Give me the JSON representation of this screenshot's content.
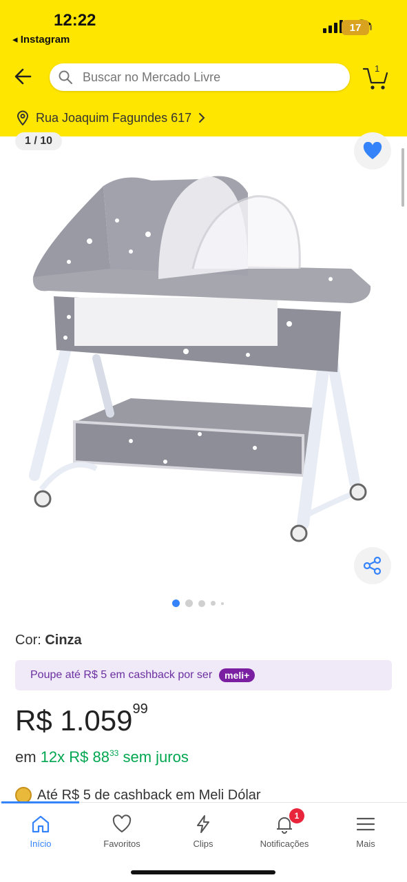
{
  "status_bar": {
    "time": "12:22",
    "back_app": "◂ Instagram",
    "battery": "17"
  },
  "search": {
    "placeholder": "Buscar no Mercado Livre"
  },
  "cart": {
    "count": "1"
  },
  "address": {
    "text": "Rua Joaquim Fagundes 617"
  },
  "gallery": {
    "counter": "1 / 10",
    "page_count": 5,
    "active_index": 0
  },
  "product": {
    "color_label": "Cor: ",
    "color_value": "Cinza",
    "cashback_text": "Poupe até R$ 5 em cashback por ser",
    "meli_badge": "meli+",
    "price_main": "R$ 1.059",
    "price_cents": "99",
    "installment_prefix": "em ",
    "installment_main": "12x R$ 88",
    "installment_cents": "33",
    "installment_suffix": " sem juros",
    "meli_dolar": "Até R$ 5 de cashback em Meli Dólar"
  },
  "bottom_nav": {
    "items": [
      {
        "label": "Início",
        "icon": "home-icon"
      },
      {
        "label": "Favoritos",
        "icon": "heart-icon"
      },
      {
        "label": "Clips",
        "icon": "lightning-icon"
      },
      {
        "label": "Notificações",
        "icon": "bell-icon"
      },
      {
        "label": "Mais",
        "icon": "menu-icon"
      }
    ],
    "notification_count": "1"
  },
  "colors": {
    "brand_yellow": "#ffe600",
    "accent_blue": "#3483fa",
    "green": "#00a650",
    "meli_purple": "#7a1fa2"
  }
}
